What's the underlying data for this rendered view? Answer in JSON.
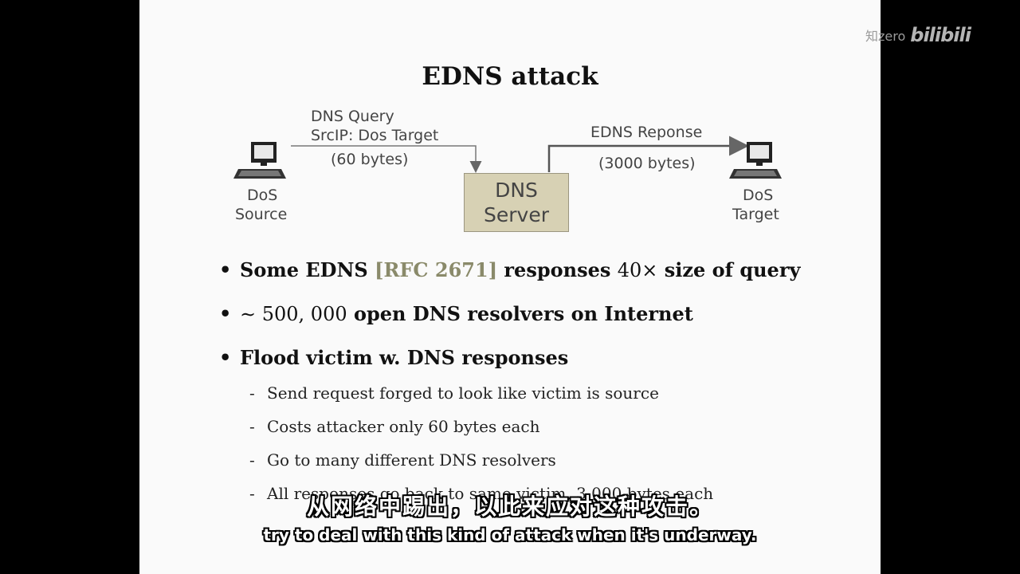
{
  "slide": {
    "title": "EDNS attack",
    "diagram": {
      "source_label_line1": "DoS",
      "source_label_line2": "Source",
      "target_label_line1": "DoS",
      "target_label_line2": "Target",
      "query_line1": "DNS Query",
      "query_line2": "SrcIP:  Dos Target",
      "query_size": "(60 bytes)",
      "server_line1": "DNS",
      "server_line2": "Server",
      "response_line1": "EDNS Reponse",
      "response_size": "(3000 bytes)",
      "server_fill_color": "#d7d1b4"
    },
    "bullets": [
      {
        "pre": "Some EDNS",
        "rfc": "[RFC 2671]",
        "mid": "responses",
        "math": "40×",
        "post": "size of query"
      },
      {
        "math": "∼ 500, 000",
        "post": "open DNS resolvers on Internet"
      },
      {
        "text": "Flood victim w. DNS responses"
      }
    ],
    "sub_bullets": [
      "Send request forged to look like victim is source",
      "Costs attacker only 60 bytes each",
      "Go to many different DNS resolvers",
      "All responses go back to same victim, 3,000 bytes each"
    ],
    "bullet_symbol": "•",
    "dash_symbol": "-"
  },
  "watermark": {
    "text": "知zero",
    "logo": "bilibili"
  },
  "subtitles": {
    "cn": "从网络中踢出，以此来应对这种攻击。",
    "en": "try to deal with this kind of attack when it's underway."
  }
}
